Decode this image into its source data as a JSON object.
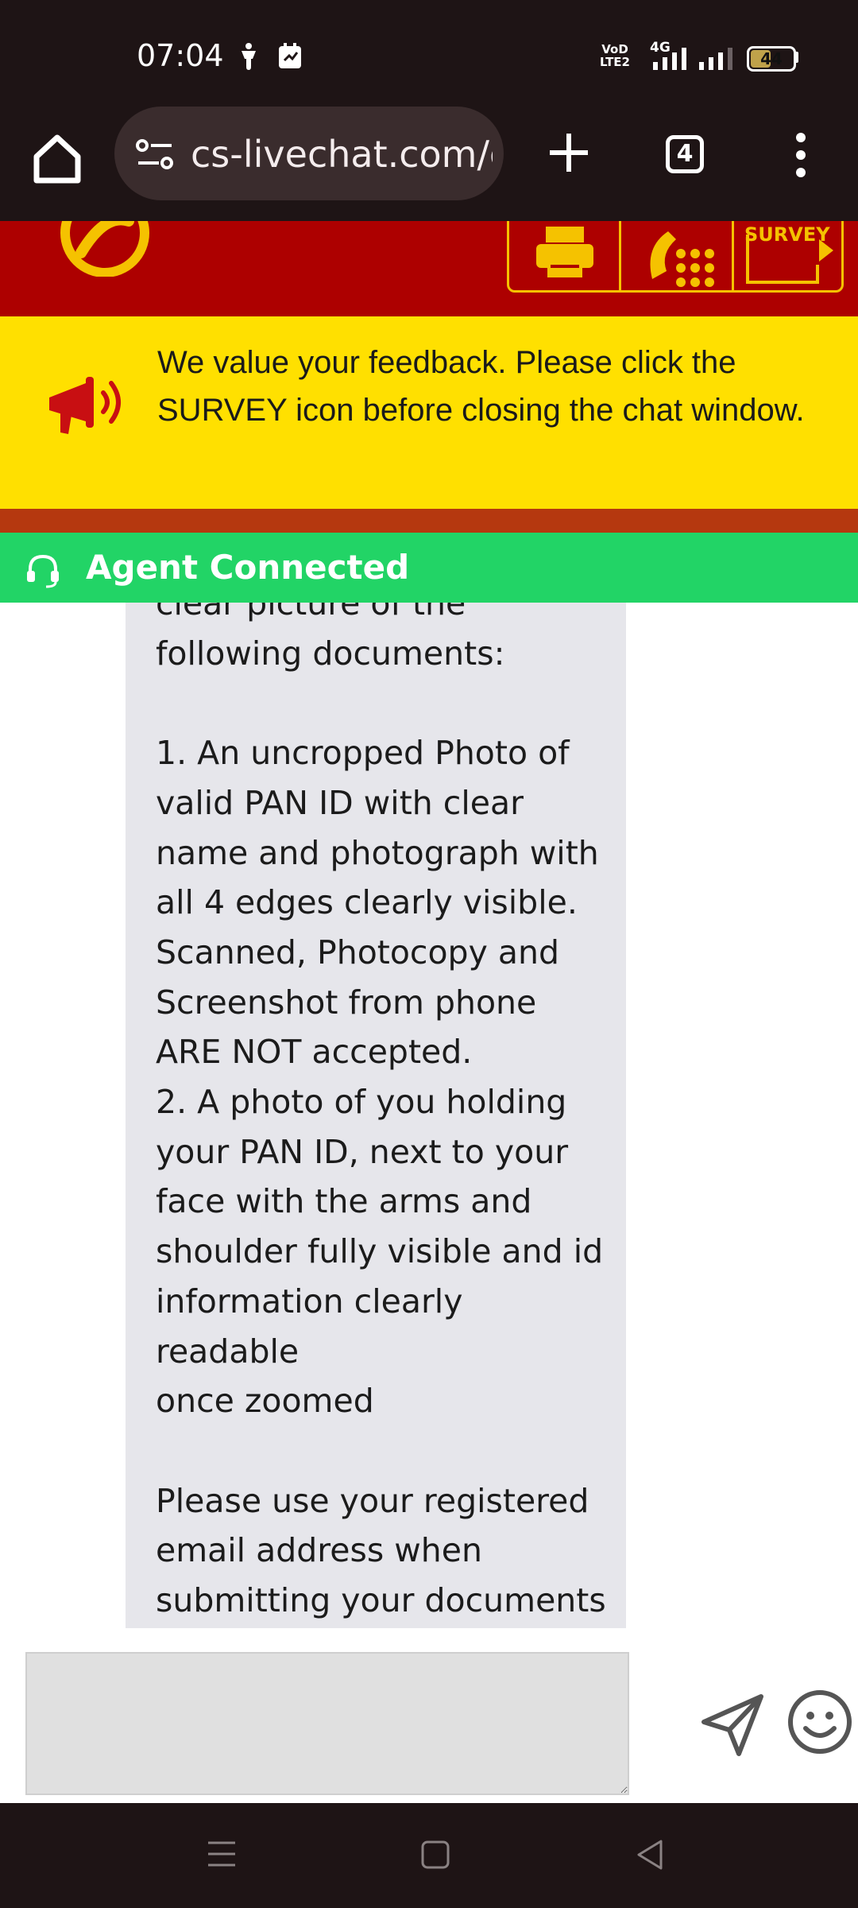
{
  "status_bar": {
    "time": "07:04",
    "volte_label": "VoD\nLTE2",
    "network_label": "4G",
    "battery_percent": "44",
    "battery_level": 0.44
  },
  "browser": {
    "url": "cs-livechat.com/c",
    "tab_count": "4",
    "icons": [
      "home-icon",
      "site-info-icon",
      "plus-icon",
      "tabs-icon",
      "more-vert-icon"
    ]
  },
  "header": {
    "survey_label": "SURVEY",
    "colors": {
      "red": "#ad0000",
      "gold": "#f5c200"
    }
  },
  "feedback_banner": {
    "text": "We value your feedback. Please click the SURVEY icon before closing the chat window.",
    "color": "#ffe000"
  },
  "agent_status": {
    "text": "Agent Connected",
    "color": "#22d466"
  },
  "chat": {
    "message": "clear picture of the\nfollowing documents:\n\n1. An uncropped Photo of\nvalid PAN ID with clear\nname and photograph with\nall 4 edges clearly visible.\nScanned, Photocopy and\nScreenshot from phone\nARE NOT accepted.\n2. A photo of you holding\nyour PAN ID, next to your\nface with the arms and\nshoulder fully visible and id\ninformation clearly readable\nonce zoomed\n\nPlease use your registered\nemail address when\nsubmitting your documents\nand send it to"
  },
  "composer": {
    "input_value": "",
    "icons": [
      "send-icon",
      "emoji-icon"
    ]
  },
  "nav_bar": {
    "icons": [
      "recents-icon",
      "home-square-icon",
      "back-triangle-icon"
    ]
  }
}
